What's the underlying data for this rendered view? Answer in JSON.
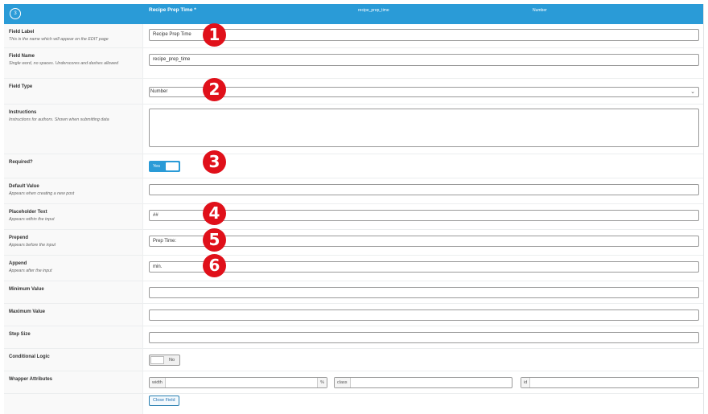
{
  "header": {
    "number": "3",
    "label": "Recipe Prep Time *",
    "name": "recipe_prep_time",
    "type": "Number",
    "color": "#2a9bd7"
  },
  "fields": {
    "label": {
      "title": "Field Label",
      "desc": "This is the name which will appear on the EDIT page",
      "value": "Recipe Prep Time"
    },
    "name": {
      "title": "Field Name",
      "desc": "Single word, no spaces. Underscores and dashes allowed",
      "value": "recipe_prep_time"
    },
    "type": {
      "title": "Field Type",
      "value": "Number"
    },
    "instructions": {
      "title": "Instructions",
      "desc": "Instructions for authors. Shown when submitting data",
      "value": ""
    },
    "required": {
      "title": "Required?",
      "value": "Yes"
    },
    "default": {
      "title": "Default Value",
      "desc": "Appears when creating a new post",
      "value": ""
    },
    "placeholder": {
      "title": "Placeholder Text",
      "desc": "Appears within the input",
      "value": "##"
    },
    "prepend": {
      "title": "Prepend",
      "desc": "Appears before the input",
      "value": "Prep Time:"
    },
    "append": {
      "title": "Append",
      "desc": "Appears after the input",
      "value": "min."
    },
    "min": {
      "title": "Minimum Value",
      "value": ""
    },
    "max": {
      "title": "Maximum Value",
      "value": ""
    },
    "step": {
      "title": "Step Size",
      "value": ""
    },
    "conditional": {
      "title": "Conditional Logic",
      "value": "No"
    },
    "wrapper": {
      "title": "Wrapper Attributes",
      "width_label": "width",
      "width_suffix": "%",
      "class_label": "class",
      "id_label": "id"
    }
  },
  "close_button": "Close Field",
  "badges": [
    "1",
    "2",
    "3",
    "4",
    "5",
    "6"
  ],
  "badge_color": "#e0101a"
}
